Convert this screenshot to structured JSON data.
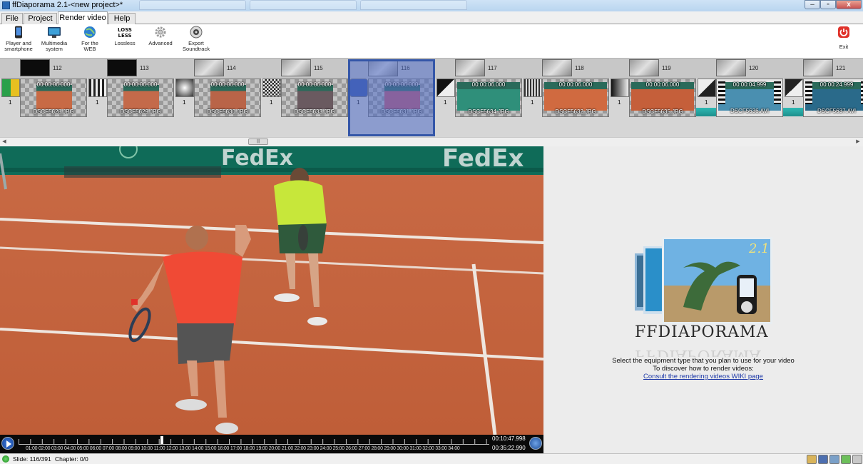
{
  "window": {
    "title": "ffDiaporama 2.1-<new project>*"
  },
  "menu": {
    "tabs": [
      {
        "label": "File"
      },
      {
        "label": "Project"
      },
      {
        "label": "Render video"
      },
      {
        "label": "Help"
      }
    ],
    "active_tab": "Render video"
  },
  "ribbon": {
    "buttons": [
      {
        "label": "Player and smartphone",
        "icon": "smartphone-icon"
      },
      {
        "label": "Multimedia system",
        "icon": "monitor-icon"
      },
      {
        "label": "For the WEB",
        "icon": "globe-icon"
      },
      {
        "label": "Lossless",
        "icon": "lossless-icon"
      },
      {
        "label": "Advanced",
        "icon": "gear-icon"
      },
      {
        "label": "Export Soundtrack",
        "icon": "speaker-icon"
      }
    ],
    "exit": {
      "label": "Exit",
      "icon": "power-icon"
    }
  },
  "timeline": {
    "headers": [
      "112",
      "113",
      "114",
      "115",
      "116",
      "117",
      "118",
      "119",
      "120",
      "121"
    ],
    "transition_counts": [
      "1",
      "1",
      "1",
      "1",
      "1",
      "1",
      "1",
      "1",
      "1",
      "1"
    ],
    "slides": [
      {
        "duration": "00:00:06.000",
        "file": "DSCF5628.JPG"
      },
      {
        "duration": "00:00:06.000",
        "file": "DSCF5629.JPG"
      },
      {
        "duration": "00:00:06.000",
        "file": "DSCF5630.JPG"
      },
      {
        "duration": "00:00:06.000",
        "file": "DSCF5633.JPG"
      },
      {
        "duration": "00:00:06.000",
        "file": "DSCF5631.JPG"
      },
      {
        "duration": "00:00:06.000",
        "file": "DSCF5634.JPG"
      },
      {
        "duration": "00:00:06.000",
        "file": "DSCF5632.JPG"
      },
      {
        "duration": "00:00:06.000",
        "file": "DSCF5635.JPG"
      },
      {
        "duration": "00:00:04.999",
        "file": "DSCF5636.AVI"
      },
      {
        "duration": "00:00:24.999",
        "file": "DSCF5637.AVI"
      }
    ],
    "selected_slide": "116",
    "scroll_thumb": "|||"
  },
  "player": {
    "time_labels": "01:00 02:00 03:00 04:00 05:00 06:00 07:00 08:00 09:00 10:00 11:00 12:00 13:00 14:00 15:00 16:00 17:00 18:00 19:00 20:00 21:00 22:00 23:00 24:00 25:00 26:00 27:00 28:00 29:00 30:00 31:00 32:00 33:00 34:00",
    "current_time": "00:10:47.998",
    "total_time": "00:35:22.990",
    "progress_fraction": 0.305
  },
  "preview": {
    "banner_text": "FedEx",
    "banner_text_2": "FedEx"
  },
  "right_panel": {
    "logo_text": "FFDIAPORAMA",
    "logo_version": "2.1",
    "line1": "Select the equipment type that you plan to use for your video",
    "line2": "To discover how to render videos:",
    "link": "Consult the rendering videos WIKI page"
  },
  "status": {
    "slide": "Slide: 116/391",
    "chapter": "Chapter: 0/0"
  },
  "colors": {
    "selection": "#3456a8",
    "clay": "#c8643e",
    "video_bar": "#2fb9b4",
    "link": "#1f3aa8"
  }
}
